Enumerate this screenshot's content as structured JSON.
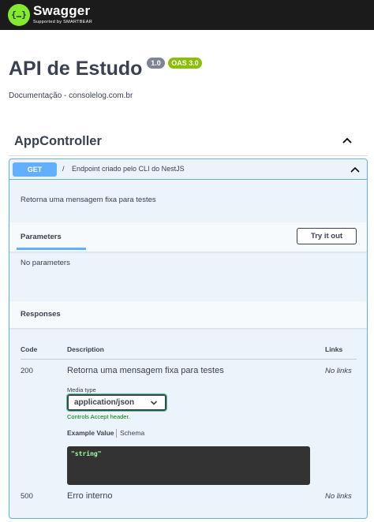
{
  "brand": {
    "logo_glyph": "{…}",
    "name": "Swagger",
    "tagline": "Supported by SMARTBEAR"
  },
  "info": {
    "title": "API de Estudo",
    "version": "1.0",
    "oas": "OAS 3.0",
    "description": "Documentação - consolelog.com.br"
  },
  "tag": {
    "name": "AppController"
  },
  "operation": {
    "method": "GET",
    "path": "/",
    "summary": "Endpoint criado pelo CLI do NestJS",
    "description": "Retorna uma mensagem fixa para testes"
  },
  "parameters": {
    "title": "Parameters",
    "try_button": "Try it out",
    "empty_text": "No parameters"
  },
  "responses": {
    "title": "Responses",
    "columns": {
      "code": "Code",
      "description": "Description",
      "links": "Links"
    },
    "rows": [
      {
        "code": "200",
        "description": "Retorna uma mensagem fixa para testes",
        "links": "No links"
      },
      {
        "code": "500",
        "description": "Erro interno",
        "links": "No links"
      }
    ],
    "media_type": {
      "label": "Media type",
      "selected": "application/json",
      "hint": "Controls Accept header."
    },
    "example_tabs": {
      "example": "Example Value",
      "schema": "Schema"
    },
    "example_code": "\"string\""
  },
  "colors": {
    "get": "#61affe",
    "topbar": "#1b1b1b",
    "brand_green": "#85ea2d",
    "version_badge": "#7d8492",
    "oas_badge": "#89bf04",
    "hint_green": "#008000",
    "code_bg": "#333333"
  }
}
